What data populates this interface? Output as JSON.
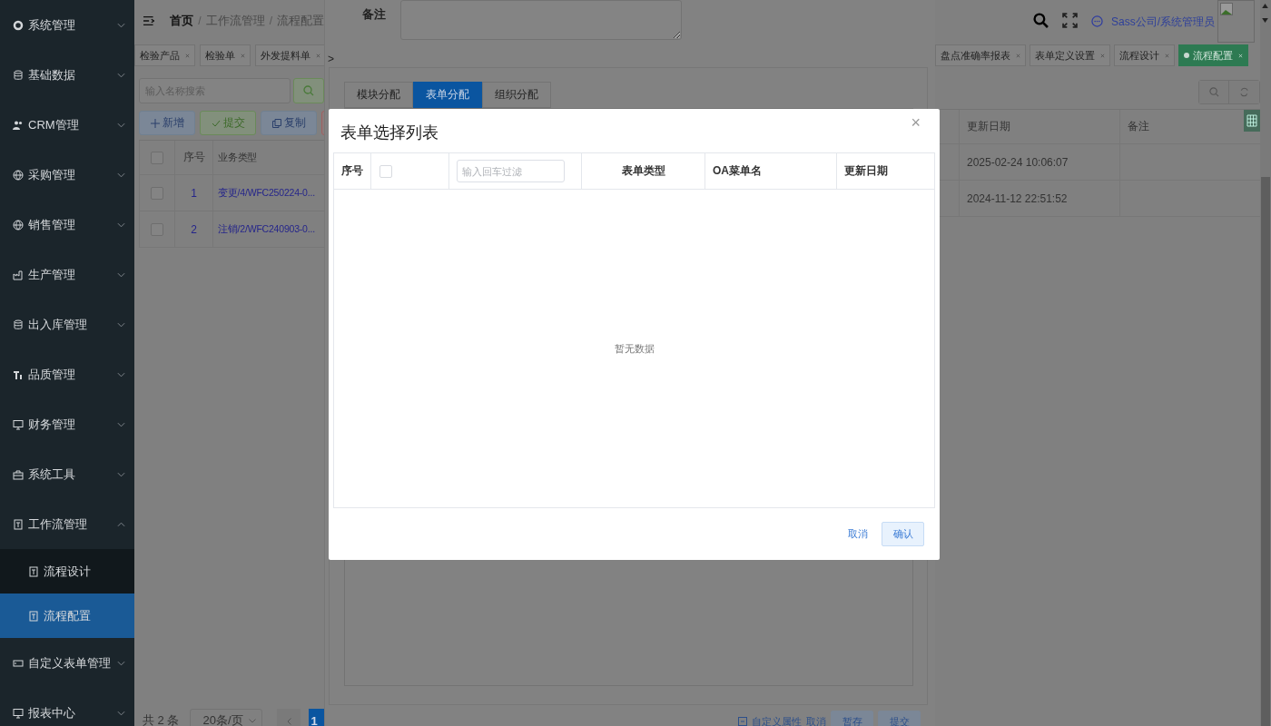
{
  "sidebar": {
    "items": [
      {
        "label": "系统管理",
        "kind": "gear",
        "expanded": false
      },
      {
        "label": "基础数据",
        "kind": "database",
        "expanded": false
      },
      {
        "label": "CRM管理",
        "kind": "users",
        "expanded": false
      },
      {
        "label": "采购管理",
        "kind": "globe",
        "expanded": false
      },
      {
        "label": "销售管理",
        "kind": "globe",
        "expanded": false
      },
      {
        "label": "生产管理",
        "kind": "factory",
        "expanded": false
      },
      {
        "label": "出入库管理",
        "kind": "database",
        "expanded": false
      },
      {
        "label": "品质管理",
        "kind": "quality",
        "expanded": false
      },
      {
        "label": "财务管理",
        "kind": "monitor",
        "expanded": false
      },
      {
        "label": "系统工具",
        "kind": "toolbox",
        "expanded": false
      },
      {
        "label": "工作流管理",
        "kind": "doc",
        "expanded": true,
        "children": [
          {
            "label": "流程设计",
            "selected": false
          },
          {
            "label": "流程配置",
            "selected": true
          }
        ]
      },
      {
        "label": "自定义表单管理",
        "kind": "form",
        "expanded": false
      },
      {
        "label": "报表中心",
        "kind": "monitor",
        "expanded": false
      }
    ]
  },
  "breadcrumb": {
    "separator": "/",
    "items": [
      "首页",
      "工作流管理",
      "流程配置"
    ]
  },
  "header": {
    "user": "Sass公司/系统管理员"
  },
  "tags_left": [
    {
      "label": "检验产品",
      "selected": false
    },
    {
      "label": "检验单",
      "selected": false
    },
    {
      "label": "外发提料单",
      "selected": false
    }
  ],
  "tags_right": [
    {
      "label": "盘点准确率报表",
      "selected": false
    },
    {
      "label": "表单定义设置",
      "selected": false
    },
    {
      "label": "流程设计",
      "selected": false
    },
    {
      "label": "流程配置",
      "selected": true
    }
  ],
  "search": {
    "placeholder": "输入名称搜索"
  },
  "toolbar": [
    {
      "label": "新增",
      "kind": "add"
    },
    {
      "label": "提交",
      "kind": "submit"
    },
    {
      "label": "复制",
      "kind": "copy"
    }
  ],
  "table": {
    "columns": [
      "序号",
      "业务类型",
      "更新日期",
      "备注"
    ],
    "all_checked": false,
    "rows": [
      {
        "checked": false,
        "index": "1",
        "type": "变更/4/WFC250224-0...",
        "updated": "2025-02-24 10:06:07"
      },
      {
        "checked": false,
        "index": "2",
        "type": "注销/2/WFC240903-0...",
        "updated": "2024-11-12 22:51:52"
      }
    ]
  },
  "pagination": {
    "total": "共 2 条",
    "page_size": "20条/页",
    "page": "1"
  },
  "drawer": {
    "remark_label": "备注",
    "arrow": ">",
    "tabs": [
      {
        "label": "模块分配",
        "selected": false
      },
      {
        "label": "表单分配",
        "selected": true
      },
      {
        "label": "组织分配",
        "selected": false
      }
    ],
    "footer": {
      "custom": "自定义属性",
      "cancel": "取消",
      "save": "暂存",
      "submit": "提交"
    }
  },
  "modal": {
    "title": "表单选择列表",
    "close": "×",
    "columns": [
      "序号",
      "表单类型",
      "OA菜单名",
      "更新日期"
    ],
    "all_checked": false,
    "filter_placeholder": "输入回车过滤",
    "empty": "暂无数据",
    "cancel": "取消",
    "confirm": "确认"
  }
}
